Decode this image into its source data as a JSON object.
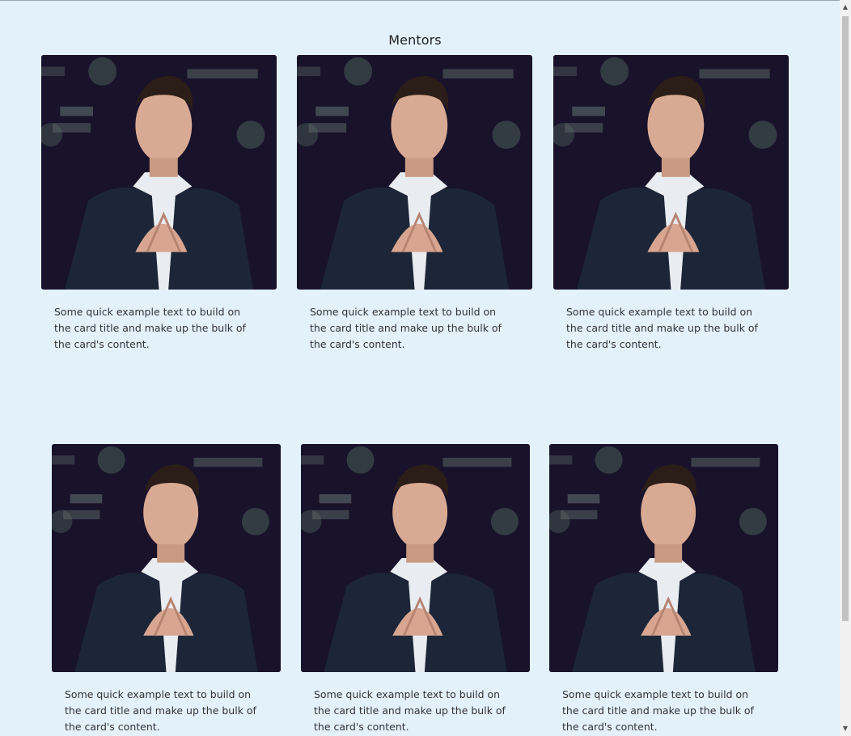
{
  "page": {
    "title": "Mentors"
  },
  "cards_row1": [
    {
      "text": "Some quick example text to build on the card title and make up the bulk of the card's content."
    },
    {
      "text": "Some quick example text to build on the card title and make up the bulk of the card's content."
    },
    {
      "text": "Some quick example text to build on the card title and make up the bulk of the card's content."
    }
  ],
  "cards_row2": [
    {
      "text": "Some quick example text to build on the card title and make up the bulk of the card's content."
    },
    {
      "text": "Some quick example text to build on the card title and make up the bulk of the card's content."
    },
    {
      "text": "Some quick example text to build on the card title and make up the bulk of the card's content."
    }
  ],
  "scrollbar": {
    "up_icon": "triangle-up-icon",
    "down_icon": "triangle-down-icon"
  }
}
